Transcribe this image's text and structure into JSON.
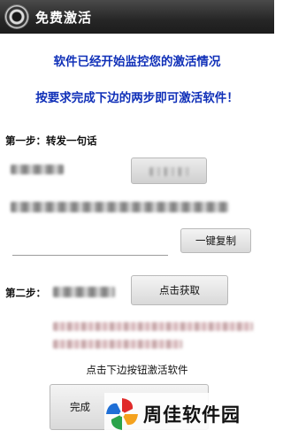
{
  "app": {
    "title": "免费激活"
  },
  "main": {
    "line1": "软件已经开始监控您的激活情况",
    "line2": "按要求完成下边的两步即可激活软件！",
    "step1": {
      "label": "第一步：转发一句话",
      "copy_button": "一键复制"
    },
    "step2": {
      "label": "第二步：",
      "fetch_button": "点击获取"
    },
    "hint": "点击下边按钮激活软件",
    "complete_button": "完成"
  },
  "watermark": {
    "text": "周佳软件园"
  }
}
